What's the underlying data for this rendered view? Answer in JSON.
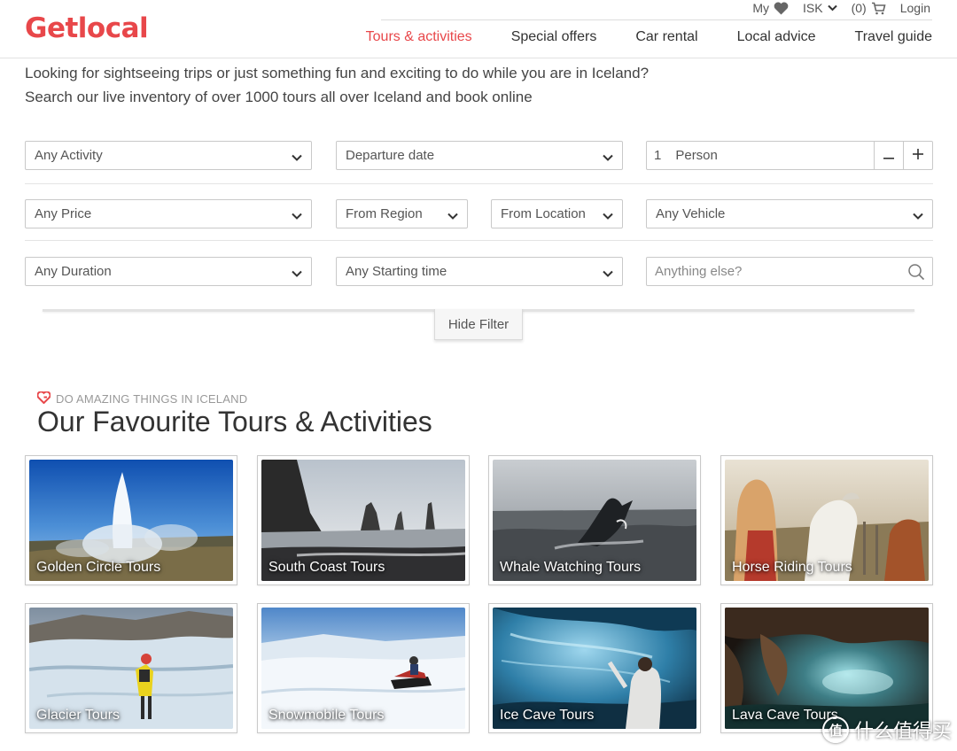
{
  "brand": {
    "logo_text": "Getlocal",
    "accent": "#e8474a"
  },
  "utility": {
    "my_label": "My",
    "currency_label": "ISK",
    "cart_count": "(0)",
    "login_label": "Login"
  },
  "nav": {
    "items": [
      {
        "label": "Tours & activities",
        "active": true
      },
      {
        "label": "Special offers"
      },
      {
        "label": "Car rental"
      },
      {
        "label": "Local advice"
      },
      {
        "label": "Travel guide"
      }
    ]
  },
  "intro": {
    "line1": "Looking for sightseeing trips or just something fun and exciting to do while you are in Iceland?",
    "line2": "Search our live inventory of over 1000 tours all over Iceland and book online"
  },
  "filters": {
    "activity": "Any Activity",
    "departure_date": "Departure date",
    "persons_count": "1",
    "persons_label": "Person",
    "price": "Any Price",
    "region": "From Region",
    "location": "From Location",
    "vehicle": "Any Vehicle",
    "duration": "Any Duration",
    "starting_time": "Any Starting time",
    "search_placeholder": "Anything else?",
    "hide_filter_label": "Hide Filter"
  },
  "section": {
    "kicker": "DO AMAZING THINGS IN ICELAND",
    "title": "Our Favourite Tours & Activities"
  },
  "tours": [
    {
      "label": "Golden Circle Tours"
    },
    {
      "label": "South Coast Tours"
    },
    {
      "label": "Whale Watching Tours"
    },
    {
      "label": "Horse Riding Tours"
    },
    {
      "label": "Glacier Tours"
    },
    {
      "label": "Snowmobile Tours"
    },
    {
      "label": "Ice Cave Tours"
    },
    {
      "label": "Lava Cave Tours"
    }
  ],
  "watermark": {
    "badge": "值",
    "text": "什么值得买"
  }
}
